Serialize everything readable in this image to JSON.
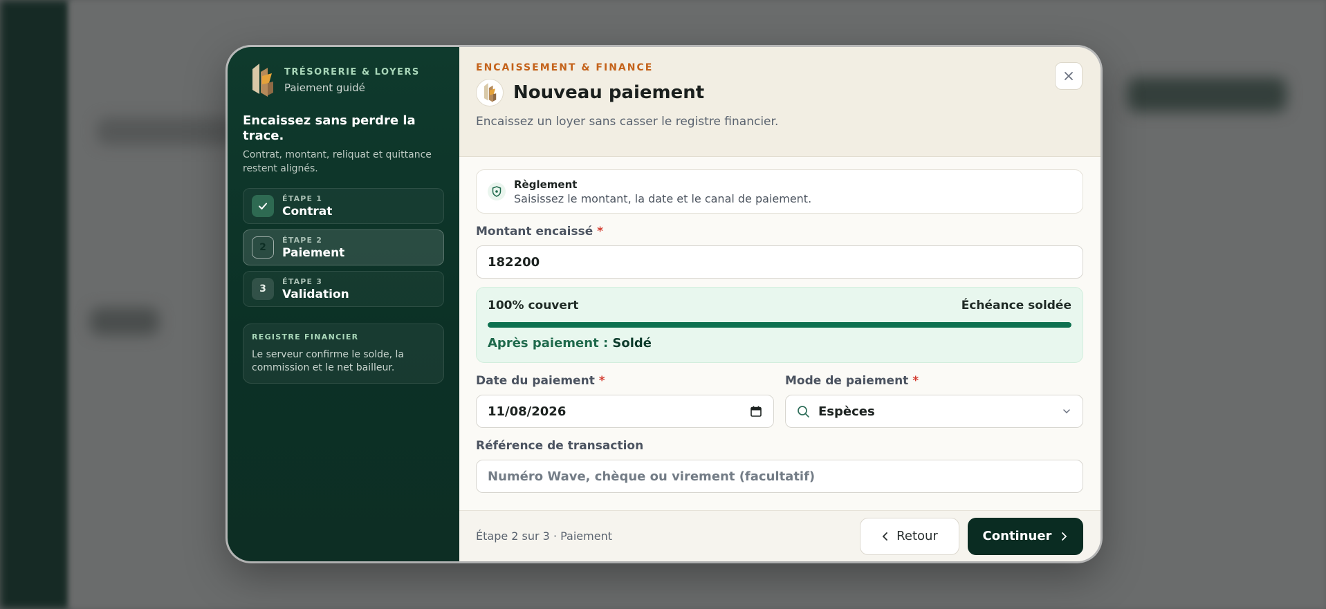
{
  "colors": {
    "accent_dark": "#0a2c22",
    "sidebar_green": "#0f3a2d",
    "kicker_orange": "#c4621a",
    "progress_green": "#0e7150",
    "required_red": "#d33b2f"
  },
  "sidebar": {
    "kicker": "TRÉSORERIE & LOYERS",
    "subtitle": "Paiement guidé",
    "lead": "Encaissez sans perdre la trace.",
    "lead_sub": "Contrat, montant, reliquat et quittance restent alignés.",
    "steps": [
      {
        "kicker": "ÉTAPE 1",
        "title": "Contrat",
        "state": "done",
        "badge": ""
      },
      {
        "kicker": "ÉTAPE 2",
        "title": "Paiement",
        "state": "active",
        "badge": "2"
      },
      {
        "kicker": "ÉTAPE 3",
        "title": "Validation",
        "state": "pending",
        "badge": "3"
      }
    ],
    "ledger": {
      "kicker": "REGISTRE FINANCIER",
      "text": "Le serveur confirme le solde, la commission et le net bailleur."
    }
  },
  "header": {
    "kicker": "ENCAISSEMENT & FINANCE",
    "title": "Nouveau paiement",
    "subtitle": "Encaissez un loyer sans casser le registre financier."
  },
  "info": {
    "title": "Règlement",
    "text": "Saisissez le montant, la date et le canal de paiement."
  },
  "form": {
    "amount_label": "Montant encaissé",
    "amount_value": "182200",
    "coverage": {
      "percent_text": "100% couvert",
      "status_text": "Échéance soldée",
      "progress": 1.0,
      "after_label": "Après paiement :",
      "after_value": "Soldé"
    },
    "date_label": "Date du paiement",
    "date_value": "11/08/2026",
    "mode_label": "Mode de paiement",
    "mode_value": "Espèces",
    "reference_label": "Référence de transaction",
    "reference_placeholder": "Numéro Wave, chèque ou virement (facultatif)",
    "required_mark": "*"
  },
  "footer": {
    "step_text": "Étape 2 sur 3 · Paiement",
    "back_label": "Retour",
    "next_label": "Continuer"
  }
}
